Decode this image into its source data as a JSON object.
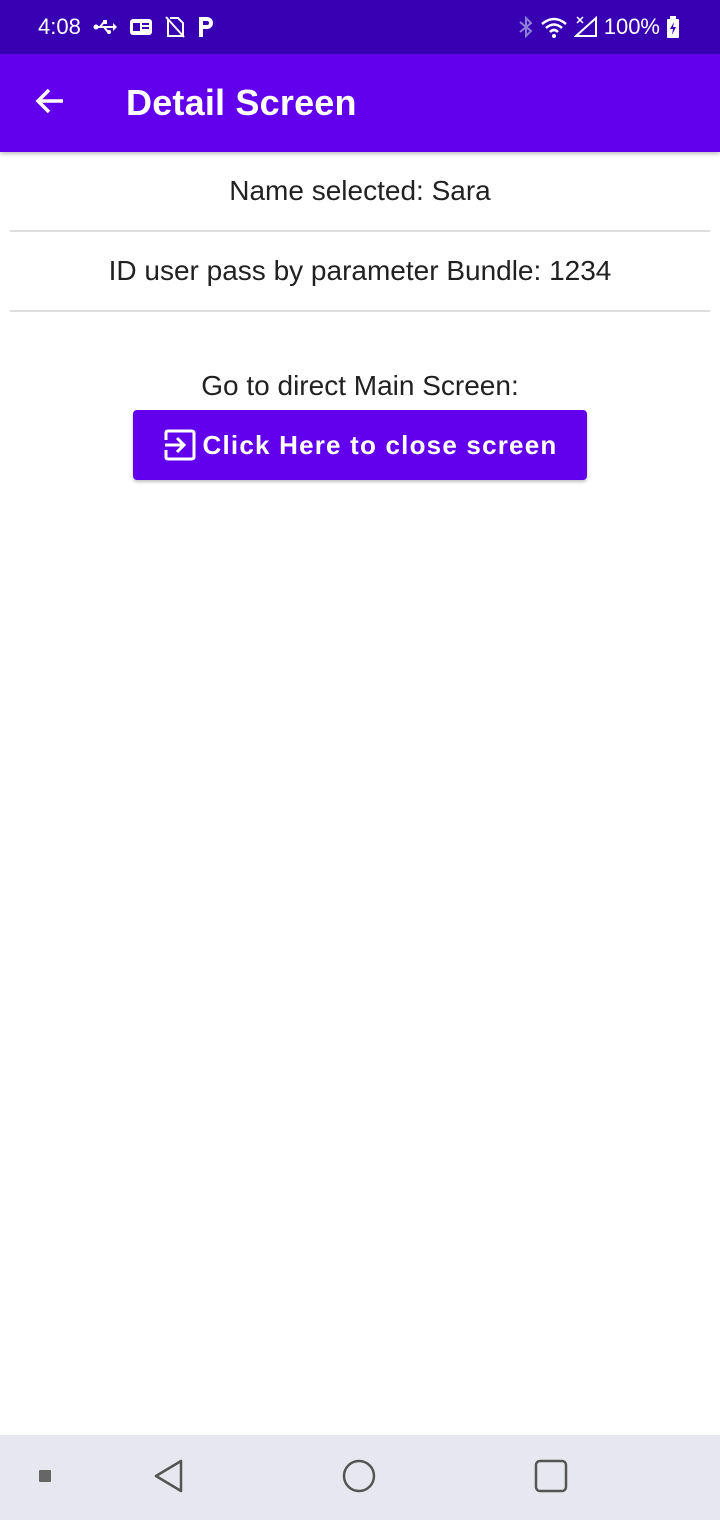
{
  "status_bar": {
    "time": "4:08",
    "battery": "100%",
    "left_icons": [
      "usb-icon",
      "sim-card-icon",
      "no-sim-icon",
      "parking-icon"
    ],
    "right_icons": [
      "bluetooth-icon",
      "wifi-icon",
      "signal-icon",
      "battery-charging-icon"
    ]
  },
  "app_bar": {
    "title": "Detail Screen",
    "back_icon": "arrow-back-icon"
  },
  "main": {
    "name_text": "Name selected: Sara",
    "id_text": "ID user pass by parameter Bundle: 1234",
    "goto_text": "Go to direct Main Screen:",
    "close_button_label": "Click Here to close screen",
    "close_button_icon": "exit-to-app-icon"
  },
  "nav_bar": {
    "icons": [
      "recent-dot-icon",
      "back-triangle-icon",
      "home-circle-icon",
      "overview-square-icon"
    ]
  },
  "colors": {
    "status_bar": "#3700b3",
    "primary": "#6200ee",
    "text": "#212121",
    "nav_bar": "#e7e7ef"
  }
}
